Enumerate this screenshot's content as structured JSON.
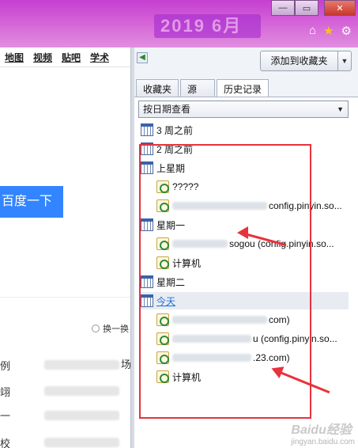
{
  "titlebar": {
    "banner_text": "2019 6月",
    "controls": {
      "minimize": "—",
      "restore": "▭",
      "close": "✕"
    }
  },
  "topicons": {
    "home": "⌂",
    "star": "★",
    "settings": "⚙"
  },
  "left": {
    "nav": [
      "地图",
      "视频",
      "贴吧",
      "学术"
    ],
    "search_button": "百度一下",
    "radio_label": "换一换",
    "rows": [
      {
        "label": "例",
        "right": "场"
      },
      {
        "label": "翊",
        "right": ""
      },
      {
        "label": "一",
        "right": ""
      },
      {
        "label": "校",
        "right": ""
      }
    ]
  },
  "panel": {
    "add_favorite": "添加到收藏夹",
    "tabs": [
      "收藏夹",
      "源",
      "历史记录"
    ],
    "active_tab": "历史记录",
    "view_select": "按日期查看",
    "items": [
      {
        "type": "folder",
        "label": "3 周之前"
      },
      {
        "type": "folder",
        "label": "2 周之前"
      },
      {
        "type": "folder",
        "label": "上星期"
      },
      {
        "type": "page",
        "label": "?????"
      },
      {
        "type": "page",
        "label": "config.pinyin.so..."
      },
      {
        "type": "folder",
        "label": "星期一"
      },
      {
        "type": "page",
        "label": "sogou (config.pinyin.so..."
      },
      {
        "type": "page",
        "label": "计算机"
      },
      {
        "type": "folder",
        "label": "星期二"
      },
      {
        "type": "folder",
        "label": "今天"
      },
      {
        "type": "page",
        "label": "com)"
      },
      {
        "type": "page",
        "label": "u (config.pinyin.so..."
      },
      {
        "type": "page",
        "label": ".23.com)"
      },
      {
        "type": "page",
        "label": "计算机"
      }
    ]
  },
  "watermark": {
    "line1": "Baidu经验",
    "line2": "jingyan.baidu.com"
  },
  "colors": {
    "annotation_red": "#e8323c",
    "search_blue": "#3385ff",
    "title_purple": "#c43fd0"
  }
}
